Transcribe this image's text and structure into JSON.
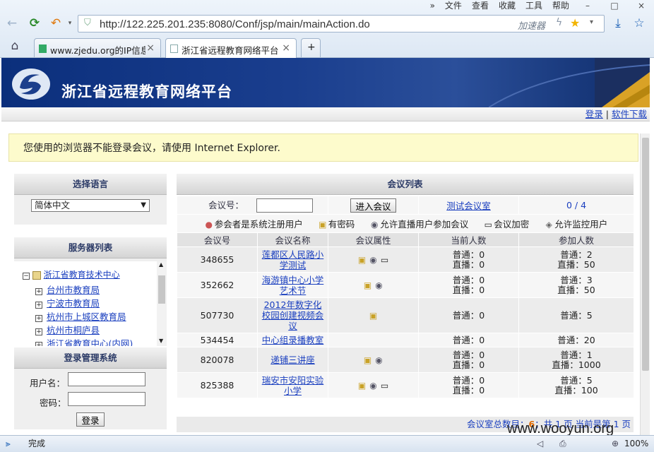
{
  "browser": {
    "menu": [
      "文件",
      "查看",
      "收藏",
      "工具",
      "帮助"
    ],
    "url": "http://122.225.201.235:8080/Conf/jsp/main/mainAction.do",
    "accelerator": "加速器",
    "tabs": [
      {
        "label": "www.zjedu.org的IP信息"
      },
      {
        "label": "浙江省远程教育网络平台"
      }
    ],
    "status": "完成",
    "zoom": "100%"
  },
  "site": {
    "title": "浙江省远程教育网络平台",
    "login_link": "登录",
    "separator": "|",
    "download_link": "软件下载",
    "warning": "您使用的浏览器不能登录会议，请使用 Internet Explorer."
  },
  "language_panel": {
    "title": "选择语言",
    "selected": "简体中文"
  },
  "server_panel": {
    "title": "服务器列表",
    "root": "浙江省教育技术中心",
    "children": [
      "台州市教育局",
      "宁波市教育局",
      "杭州市上城区教育局",
      "杭州市桐庐县",
      "浙江省教育中心(内网)"
    ]
  },
  "login_panel": {
    "title": "登录管理系统",
    "username_label": "用户名：",
    "password_label": "密码：",
    "submit": "登录"
  },
  "meetings": {
    "title": "会议列表",
    "id_label": "会议号：",
    "enter_button": "进入会议",
    "test_room": "测试会议室",
    "ratio": "0 / 4",
    "legend": [
      "参会者是系统注册用户",
      "有密码",
      "允许直播用户参加会议",
      "会议加密",
      "允许监控用户"
    ],
    "columns": [
      "会议号",
      "会议名称",
      "会议属性",
      "当前人数",
      "参加人数"
    ],
    "rows": [
      {
        "id": "348655",
        "name": "莲都区人民路小学测试",
        "cur1": "普通：0",
        "cur2": "直播：0",
        "par1": "普通：2",
        "par2": "直播：50"
      },
      {
        "id": "352662",
        "name": "海游镇中心小学艺术节",
        "cur1": "普通：0",
        "cur2": "直播：0",
        "par1": "普通：3",
        "par2": "直播：50"
      },
      {
        "id": "507730",
        "name": "2012年数字化校园创建视频会议",
        "cur1": "普通：0",
        "cur2": "",
        "par1": "普通：5",
        "par2": ""
      },
      {
        "id": "534454",
        "name": "中心组录播教室",
        "cur1": "普通：0",
        "cur2": "",
        "par1": "普通：20",
        "par2": ""
      },
      {
        "id": "820078",
        "name": "递铺三讲座",
        "cur1": "普通：0",
        "cur2": "直播：0",
        "par1": "普通：1",
        "par2": "直播：1000"
      },
      {
        "id": "825388",
        "name": "瑞安市安阳实验小学",
        "cur1": "普通：0",
        "cur2": "直播：0",
        "par1": "普通：5",
        "par2": "直播：100"
      }
    ],
    "footer": {
      "total_label": "会议室总数目：",
      "total": "6",
      "pages": "；共 1 页 当前是第 1 页"
    }
  },
  "watermark": "www.wooyun.org",
  "colors": {
    "header_bg": "#0b2f7c",
    "link": "#1a3fbf",
    "warning_bg": "#fdfbcc"
  }
}
